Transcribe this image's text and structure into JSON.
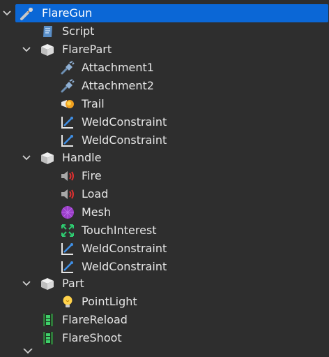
{
  "tree": {
    "nodes": [
      {
        "id": "flaregun",
        "label": "FlareGun",
        "icon": "tool-icon",
        "expanded": true,
        "selected": true
      },
      {
        "id": "script",
        "label": "Script",
        "icon": "script-icon"
      },
      {
        "id": "flarepart",
        "label": "FlarePart",
        "icon": "part-icon",
        "expanded": true
      },
      {
        "id": "attachment1",
        "label": "Attachment1",
        "icon": "attachment-icon"
      },
      {
        "id": "attachment2",
        "label": "Attachment2",
        "icon": "attachment-icon"
      },
      {
        "id": "trail",
        "label": "Trail",
        "icon": "trail-icon"
      },
      {
        "id": "weld1",
        "label": "WeldConstraint",
        "icon": "weld-constraint-icon"
      },
      {
        "id": "weld2",
        "label": "WeldConstraint",
        "icon": "weld-constraint-icon"
      },
      {
        "id": "handle",
        "label": "Handle",
        "icon": "part-icon",
        "expanded": true
      },
      {
        "id": "fire",
        "label": "Fire",
        "icon": "sound-icon"
      },
      {
        "id": "load",
        "label": "Load",
        "icon": "sound-icon"
      },
      {
        "id": "mesh",
        "label": "Mesh",
        "icon": "mesh-icon"
      },
      {
        "id": "touch",
        "label": "TouchInterest",
        "icon": "touch-interest-icon"
      },
      {
        "id": "weld3",
        "label": "WeldConstraint",
        "icon": "weld-constraint-icon"
      },
      {
        "id": "weld4",
        "label": "WeldConstraint",
        "icon": "weld-constraint-icon"
      },
      {
        "id": "part",
        "label": "Part",
        "icon": "part-icon",
        "expanded": true
      },
      {
        "id": "pointlight",
        "label": "PointLight",
        "icon": "point-light-icon"
      },
      {
        "id": "flarereload",
        "label": "FlareReload",
        "icon": "animation-icon"
      },
      {
        "id": "flareshoot",
        "label": "FlareShoot",
        "icon": "animation-icon"
      }
    ]
  },
  "colors": {
    "background": "#2e2e2e",
    "selection": "#0b67d6",
    "text": "#e6e6e6"
  }
}
